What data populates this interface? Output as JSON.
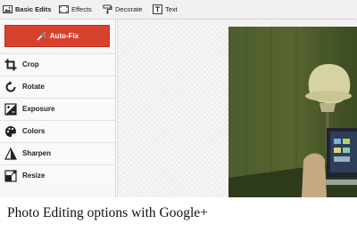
{
  "toolbar": {
    "tabs": [
      {
        "label": "Basic Edits",
        "icon": "image-icon"
      },
      {
        "label": "Effects",
        "icon": "film-icon"
      },
      {
        "label": "Decorate",
        "icon": "paint-roller-icon"
      },
      {
        "label": "Text",
        "icon": "text-icon"
      }
    ]
  },
  "sidebar": {
    "autofix_label": "Auto-Fix",
    "tools": [
      {
        "label": "Crop",
        "icon": "crop-icon"
      },
      {
        "label": "Rotate",
        "icon": "rotate-icon"
      },
      {
        "label": "Exposure",
        "icon": "exposure-icon"
      },
      {
        "label": "Colors",
        "icon": "palette-icon"
      },
      {
        "label": "Sharpen",
        "icon": "sharpen-icon"
      },
      {
        "label": "Resize",
        "icon": "resize-icon"
      }
    ]
  },
  "caption": "Photo Editing options with Google+",
  "colors": {
    "accent": "#d9412f",
    "toolbar_bg": "#f1f1f1",
    "sidebar_bg": "#f7f7f7"
  }
}
